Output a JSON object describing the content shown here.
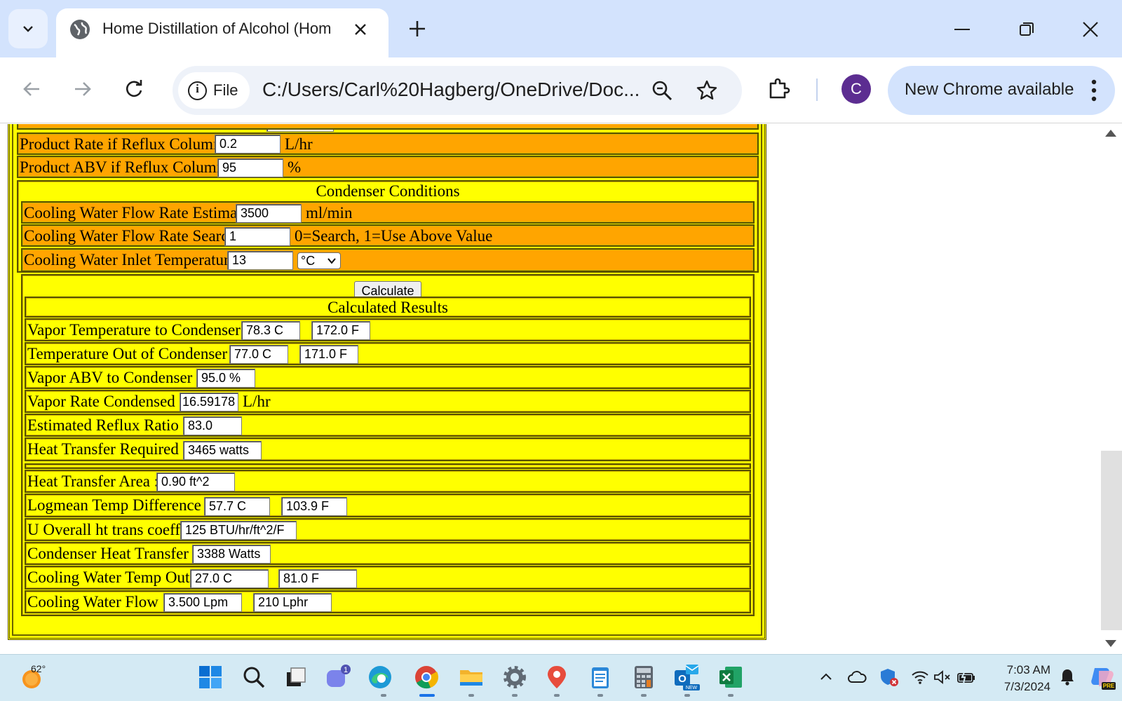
{
  "browser": {
    "tab_title": "Home Distillation of Alcohol (Hom",
    "url_scheme": "File",
    "url": "C:/Users/Carl%20Hagberg/OneDrive/Doc...",
    "profile_initial": "C",
    "update_label": "New Chrome available"
  },
  "form": {
    "product_rate": {
      "label": "Product Rate if Reflux Column",
      "value": "0.2",
      "unit": "L/hr"
    },
    "product_abv": {
      "label": "Product ABV if Reflux Column",
      "value": "95",
      "unit": "%"
    },
    "condenser_title": "Condenser Conditions",
    "cw_flow_estimate": {
      "label": "Cooling Water Flow Rate Estimate",
      "value": "3500",
      "unit": "ml/min"
    },
    "cw_flow_search": {
      "label": "Cooling Water Flow Rate Search",
      "value": "1",
      "unit": "0=Search, 1=Use Above Value"
    },
    "cw_inlet_temp": {
      "label": "Cooling Water Inlet Temperature",
      "value": "13",
      "unit_select": "°C"
    },
    "calculate_label": "Calculate"
  },
  "results": {
    "title": "Calculated Results",
    "vapor_temp": {
      "label": "Vapor Temperature to Condenser :",
      "c": "78.3 C",
      "f": "172.0 F"
    },
    "temp_out": {
      "label": "Temperature Out of Condenser :",
      "c": "77.0 C",
      "f": "171.0 F"
    },
    "vapor_abv": {
      "label": "Vapor ABV to Condenser :",
      "value": "95.0 %"
    },
    "vapor_rate": {
      "label": "Vapor Rate Condensed :",
      "value": "16.59178",
      "unit": "L/hr"
    },
    "reflux_ratio": {
      "label": "Estimated Reflux Ratio :",
      "value": "83.0"
    },
    "heat_required": {
      "label": "Heat Transfer Required :",
      "value": "3465 watts"
    },
    "heat_area": {
      "label": "Heat Transfer Area :",
      "value": "0.90 ft^2"
    },
    "logmean": {
      "label": "Logmean Temp Difference :",
      "c": "57.7 C",
      "f": "103.9 F"
    },
    "u_overall": {
      "label": "U Overall ht trans coeff:",
      "value": "125 BTU/hr/ft^2/F"
    },
    "condenser_heat": {
      "label": "Condenser Heat Transfer :",
      "value": "3388 Watts"
    },
    "cw_temp_out": {
      "label": "Cooling Water Temp Out:",
      "c": "27.0 C",
      "f": "81.0 F"
    },
    "cw_flow": {
      "label": "Cooling Water Flow :",
      "lpm": "3.500 Lpm",
      "lphr": "210 Lphr"
    }
  },
  "taskbar": {
    "weather_temp": "62°",
    "chat_badge": "1",
    "outlook_badge": "NEW",
    "copilot_badge": "PRE",
    "time": "7:03 AM",
    "date": "7/3/2024"
  },
  "colors": {
    "row_orange": "#ffa500",
    "row_yellow": "#ffff00",
    "tab_strip": "#d3e3fd"
  }
}
